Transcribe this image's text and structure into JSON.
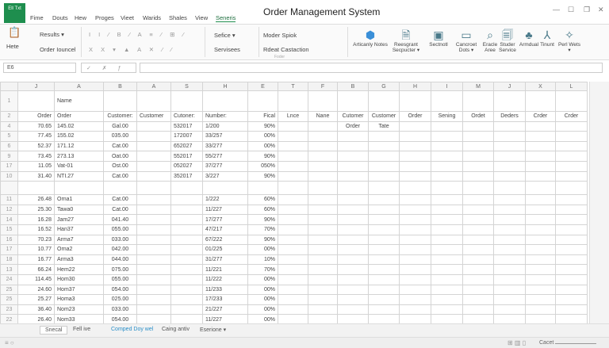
{
  "app": {
    "logo_text": "Ell Txt",
    "title": "Order Management System"
  },
  "menu_tabs": [
    "Fime",
    "Douts",
    "Hew",
    "Proges",
    "Vieet",
    "Warids",
    "Shales",
    "View",
    "Seneris"
  ],
  "active_tab_index": 8,
  "ribbon": {
    "paste": "Hete",
    "results": "Results ▾",
    "order_council": "Order Iouncel",
    "sfice": "Sefice ▾",
    "services": "Servisees",
    "moder_spiok": "Moder Spiok",
    "rdeat": "Rdeat Castaction",
    "group_label": "Foder",
    "big_buttons": [
      "Articanly Notes",
      "Reesgrant Secpucter ▾",
      "Sectnotl",
      "Cancroet Dots ▾",
      "Eracle Aree",
      "Studer Service",
      "Armdual",
      "Tinunt",
      "Perl Wets ▾"
    ]
  },
  "name_box": "E6",
  "fx_label": "✓ ✗ ƒ",
  "sheet": {
    "columns": [
      "J",
      "A",
      "B",
      "A",
      "S",
      "H",
      "E",
      "T",
      "F",
      "B",
      "G",
      "H",
      "I",
      "M",
      "J",
      "X",
      "L"
    ],
    "rows": [
      {
        "n": "1",
        "cells": [
          "",
          "Name"
        ]
      },
      {
        "n": "2",
        "cells": [
          "Order",
          "Order",
          "Customer:",
          "Customer",
          "Cutoner:",
          "Number:",
          "Fical",
          "Lnce",
          "Nane",
          "Cutomer",
          "Customer",
          "Order",
          "Sening",
          "Ordet",
          "Deders",
          "Crder",
          "Crder"
        ]
      },
      {
        "n": "4",
        "cells": [
          "70.65",
          "145.02",
          "Gal.00",
          "",
          "532017",
          "1/200",
          "90%",
          "",
          "",
          "Order",
          "Tate"
        ]
      },
      {
        "n": "5",
        "cells": [
          "77.45",
          "155.02",
          "035.00",
          "",
          "172007",
          "33/257",
          "00%"
        ]
      },
      {
        "n": "6",
        "cells": [
          "52.37",
          "171.12",
          "Cat.00",
          "",
          "652027",
          "33/277",
          "00%"
        ]
      },
      {
        "n": "9",
        "cells": [
          "73.45",
          "273.13",
          "Oat.00",
          "",
          "552017",
          "55/277",
          "90%"
        ]
      },
      {
        "n": "17",
        "cells": [
          "11.05",
          "Vat-01",
          "Ost.00",
          "",
          "052027",
          "37/277",
          "050%"
        ]
      },
      {
        "n": "10",
        "cells": [
          "31.40",
          "NTI.27",
          "Cat.00",
          "",
          "352017",
          "3/227",
          "90%"
        ]
      },
      {
        "n": "",
        "cells": []
      },
      {
        "n": "11",
        "cells": [
          "26.48",
          "Orna1",
          "Cat.00",
          "",
          "",
          "1/222",
          "60%"
        ]
      },
      {
        "n": "12",
        "cells": [
          "25.30",
          "Tawa0",
          "Cat.00",
          "",
          "",
          "11/227",
          "60%"
        ]
      },
      {
        "n": "14",
        "cells": [
          "16.28",
          "Jam27",
          "041.40",
          "",
          "",
          "17/277",
          "90%"
        ]
      },
      {
        "n": "15",
        "cells": [
          "16.52",
          "Han37",
          "055.00",
          "",
          "",
          "47/217",
          "70%"
        ]
      },
      {
        "n": "16",
        "cells": [
          "70.23",
          "Arma7",
          "033.00",
          "",
          "",
          "67/222",
          "90%"
        ]
      },
      {
        "n": "17",
        "cells": [
          "10.77",
          "Orna2",
          "042.00",
          "",
          "",
          "01/225",
          "00%"
        ]
      },
      {
        "n": "18",
        "cells": [
          "16.77",
          "Arma3",
          "044.00",
          "",
          "",
          "31/277",
          "10%"
        ]
      },
      {
        "n": "13",
        "cells": [
          "66.24",
          "Hem22",
          "075.00",
          "",
          "",
          "11/221",
          "70%"
        ]
      },
      {
        "n": "24",
        "cells": [
          "114.45",
          "Hom30",
          "055.00",
          "",
          "",
          "11/222",
          "00%"
        ]
      },
      {
        "n": "25",
        "cells": [
          "24.60",
          "Hom37",
          "054.00",
          "",
          "",
          "11/233",
          "00%"
        ]
      },
      {
        "n": "25",
        "cells": [
          "25.27",
          "Homa3",
          "025.00",
          "",
          "",
          "17/233",
          "00%"
        ]
      },
      {
        "n": "23",
        "cells": [
          "36.40",
          "Nom23",
          "033.00",
          "",
          "",
          "21/227",
          "00%"
        ]
      },
      {
        "n": "22",
        "cells": [
          "26.40",
          "Nom33",
          "054.00",
          "",
          "",
          "11/227",
          "00%"
        ]
      }
    ]
  },
  "sheet_tabs": [
    "Snecal",
    "Fell ive",
    "Comped Doy wel",
    "Caing antiv",
    "Eserione ▾"
  ],
  "active_sheet_index": 2,
  "status": {
    "zoom_label": "Cacet"
  }
}
